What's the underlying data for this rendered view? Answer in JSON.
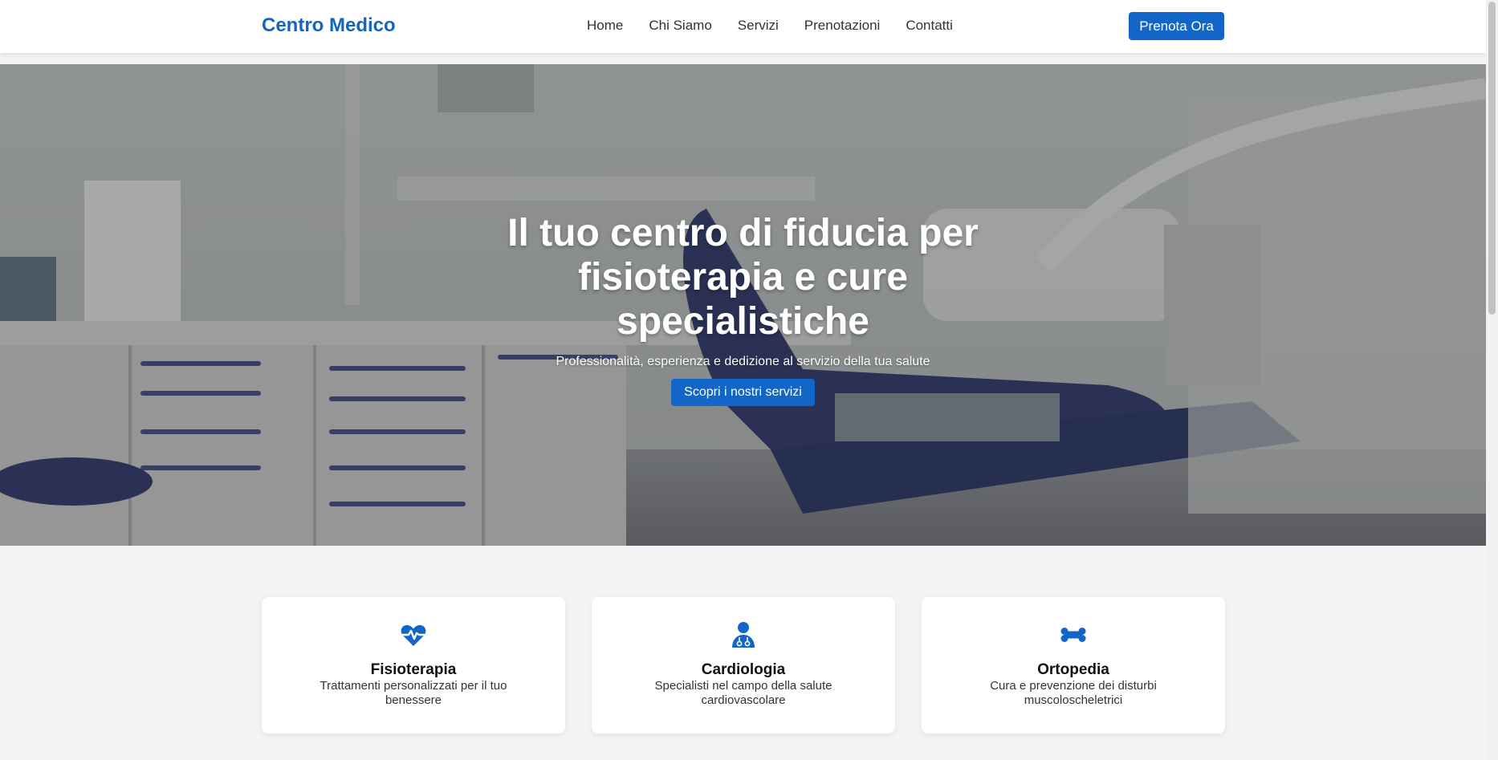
{
  "header": {
    "brand": "Centro Medico",
    "nav": [
      "Home",
      "Chi Siamo",
      "Servizi",
      "Prenotazioni",
      "Contatti"
    ],
    "cta_label": "Prenota Ora"
  },
  "hero": {
    "title": "Il tuo centro di fiducia per fisioterapia e cure specialistiche",
    "subtitle": "Professionalità, esperienza e dedizione al servizio della tua salute",
    "button_label": "Scopri i nostri servizi"
  },
  "services": [
    {
      "icon": "heart-pulse-icon",
      "title": "Fisioterapia",
      "description": "Trattamenti personalizzati per il tuo benessere"
    },
    {
      "icon": "doctor-icon",
      "title": "Cardiologia",
      "description": "Specialisti nel campo della salute cardiovascolare"
    },
    {
      "icon": "bone-icon",
      "title": "Ortopedia",
      "description": "Cura e prevenzione dei disturbi muscoloscheletrici"
    }
  ],
  "colors": {
    "primary": "#1266c8",
    "brand_text": "#1565c0",
    "background": "#f4f4f4"
  }
}
